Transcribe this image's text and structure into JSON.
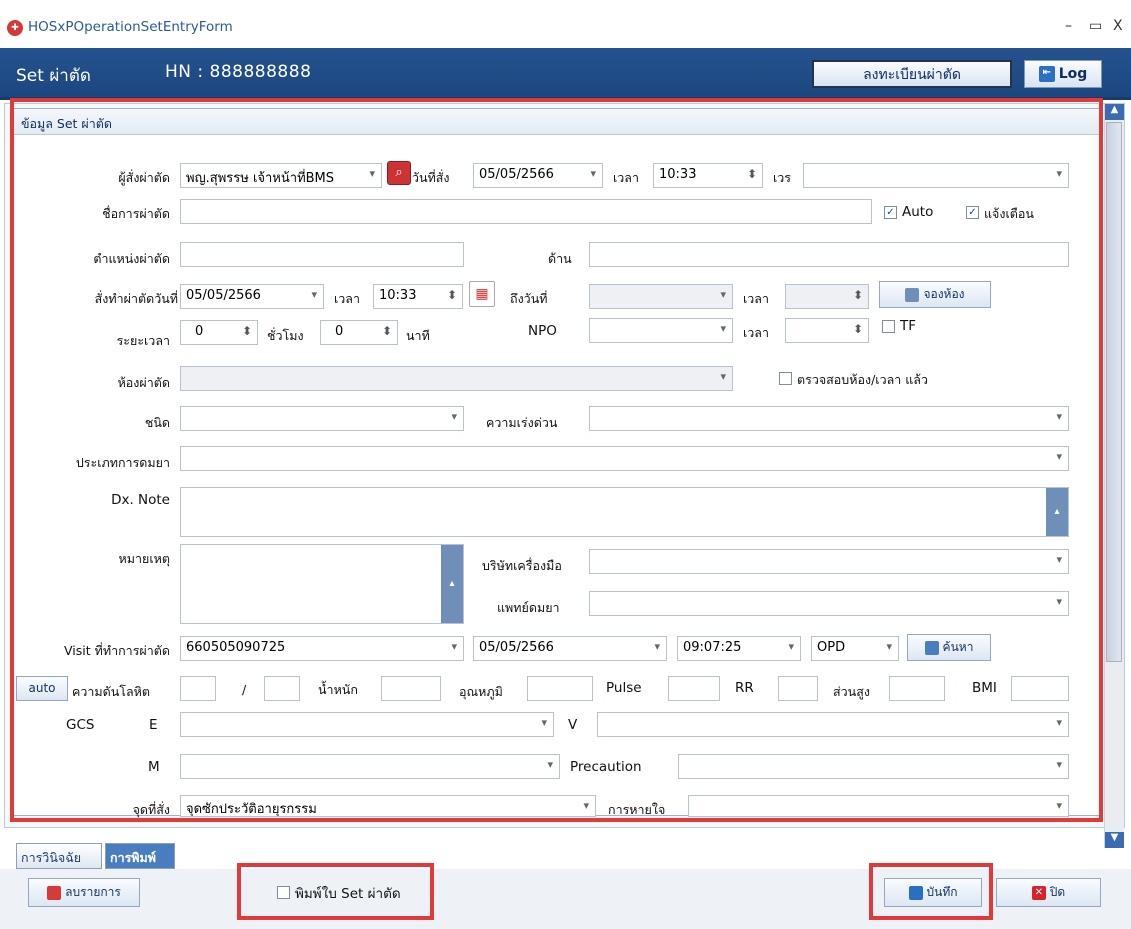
{
  "window": {
    "title": "HOSxPOperationSetEntryForm",
    "min": "–",
    "max": "▭",
    "close": "X"
  },
  "header": {
    "title": "Set ผ่าตัด",
    "hn": "HN : 888888888",
    "register_btn": "ลงทะเบียนผ่าตัด",
    "log_btn": "Log"
  },
  "section": {
    "title": "ข้อมูล Set ผ่าตัด"
  },
  "form": {
    "orderer_label": "ผู้สั่งผ่าตัด",
    "orderer_value": "พญ.สุพรรษ เจ้าหน้าที่BMS",
    "order_date_label": "วันที่สั่ง",
    "order_date": "05/05/2566",
    "time_label": "เวลา",
    "order_time": "10:33",
    "shift_label": "เวร",
    "shift_value": "",
    "op_name_label": "ชื่อการผ่าตัด",
    "op_name": "",
    "auto_label": "Auto",
    "notify_label": "แจ้งเตือน",
    "position_label": "ตำแหน่งผ่าตัด",
    "side_label": "ด้าน",
    "op_date_label": "สั่งทำผ่าตัดวันที่",
    "op_date": "05/05/2566",
    "op_time": "10:33",
    "to_date_label": "ถึงวันที่",
    "book_room": "จองห้อง",
    "duration_label": "ระยะเวลา",
    "hours": "0",
    "hours_label": "ชั่วโมง",
    "minutes": "0",
    "minutes_label": "นาที",
    "npo_label": "NPO",
    "tf_label": "TF",
    "room_label": "ห้องผ่าตัด",
    "room_checked_label": "ตรวจสอบห้อง/เวลา แล้ว",
    "type_label": "ชนิด",
    "urgency_label": "ความเร่งด่วน",
    "anes_type_label": "ประเภทการดมยา",
    "dx_note_label": "Dx. Note",
    "remark_label": "หมายเหตุ",
    "tool_company_label": "บริษัทเครื่องมือ",
    "anesthetist_label": "แพทย์ดมยา",
    "visit_label": "Visit ที่ทำการผ่าตัด",
    "visit_vn": "660505090725",
    "visit_date": "05/05/2566",
    "visit_time": "09:07:25",
    "visit_type": "OPD",
    "search_btn": "ค้นหา",
    "auto_btn": "auto",
    "bp_label": "ความดันโลหิต",
    "slash": "/",
    "weight_label": "น้ำหนัก",
    "temp_label": "อุณหภูมิ",
    "pulse_label": "Pulse",
    "rr_label": "RR",
    "height_label": "ส่วนสูง",
    "bmi_label": "BMI",
    "gcs_label": "GCS",
    "e_label": "E",
    "v_label": "V",
    "m_label": "M",
    "precaution_label": "Precaution",
    "order_point_label": "จุดที่สั่ง",
    "order_point": "จุดซักประวัติอายุรกรรม",
    "breathing_label": "การหายใจ"
  },
  "tabs": [
    "การวินิจฉัย",
    "การพิมพ์"
  ],
  "footer": {
    "delete_btn": "ลบรายการ",
    "print_label": "พิมพ์ใบ Set ผ่าตัด",
    "save_btn": "บันทึก",
    "close_btn": "ปิด"
  },
  "colors": {
    "header": "#1f4a84",
    "highlight": "#e23a3a"
  }
}
